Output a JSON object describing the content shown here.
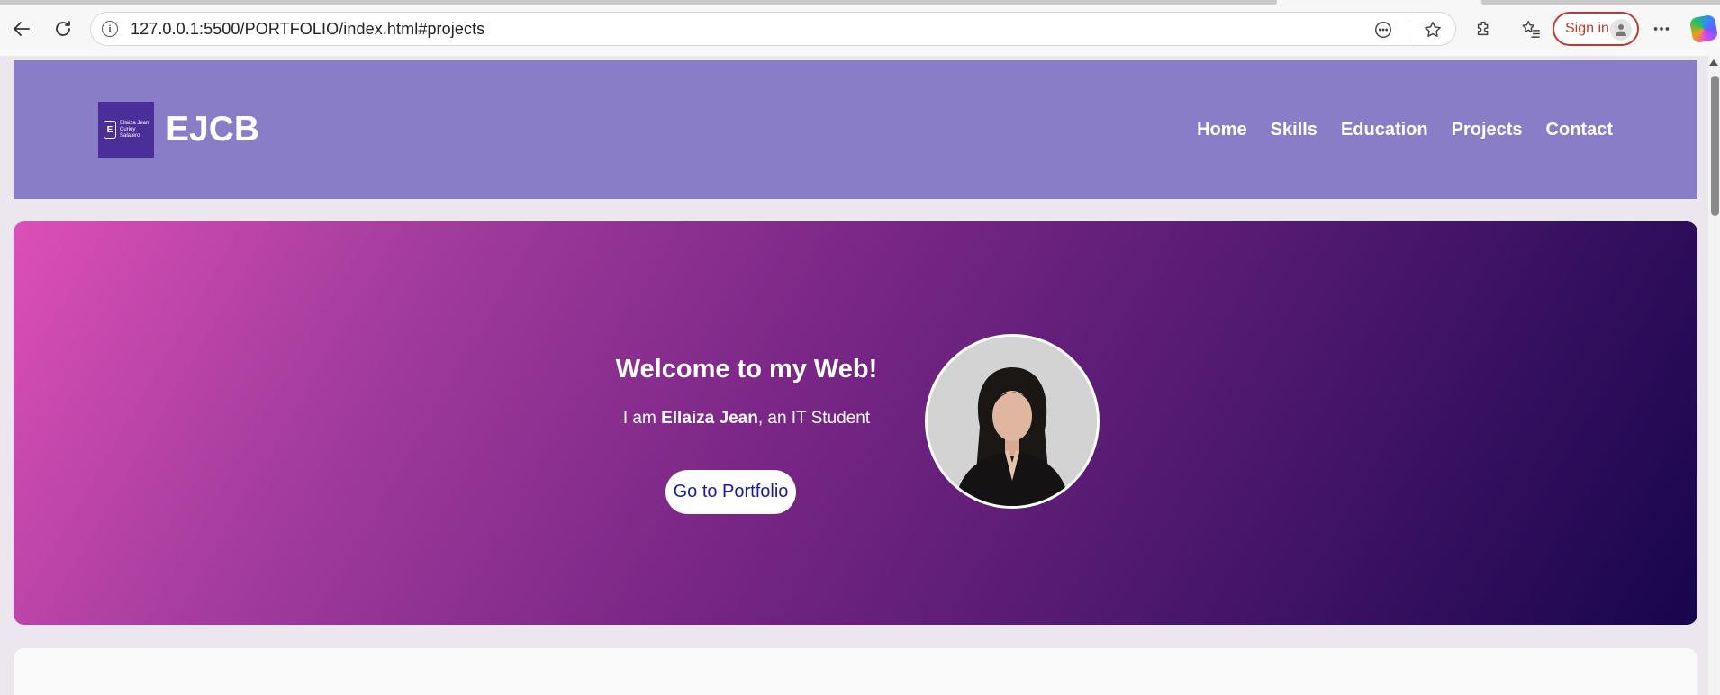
{
  "browser": {
    "url": "127.0.0.1:5500/PORTFOLIO/index.html#projects",
    "signin_label": "Sign in"
  },
  "header": {
    "logo_text": "Ellaiza Jean\nCurioy\nSalatero",
    "brand": "EJCB",
    "nav": [
      "Home",
      "Skills",
      "Education",
      "Projects",
      "Contact"
    ]
  },
  "hero": {
    "title": "Welcome to my Web!",
    "subtitle_prefix": "I am ",
    "subtitle_name": "Ellaiza Jean",
    "subtitle_suffix": ", an IT Student",
    "cta_label": "Go to Portfolio"
  },
  "colors": {
    "header_bg": "#8a7dc8",
    "logo_bg": "#4a2e9a",
    "hero_gradient_start": "#dc4fb8",
    "hero_gradient_end": "#17054d",
    "cta_text": "#1a1aa0",
    "signin_accent": "#c0392b"
  },
  "icons": [
    "back-icon",
    "refresh-icon",
    "info-icon",
    "reader-icon",
    "star-icon",
    "extensions-icon",
    "favorites-icon",
    "profile-icon",
    "more-icon",
    "copilot-icon"
  ]
}
